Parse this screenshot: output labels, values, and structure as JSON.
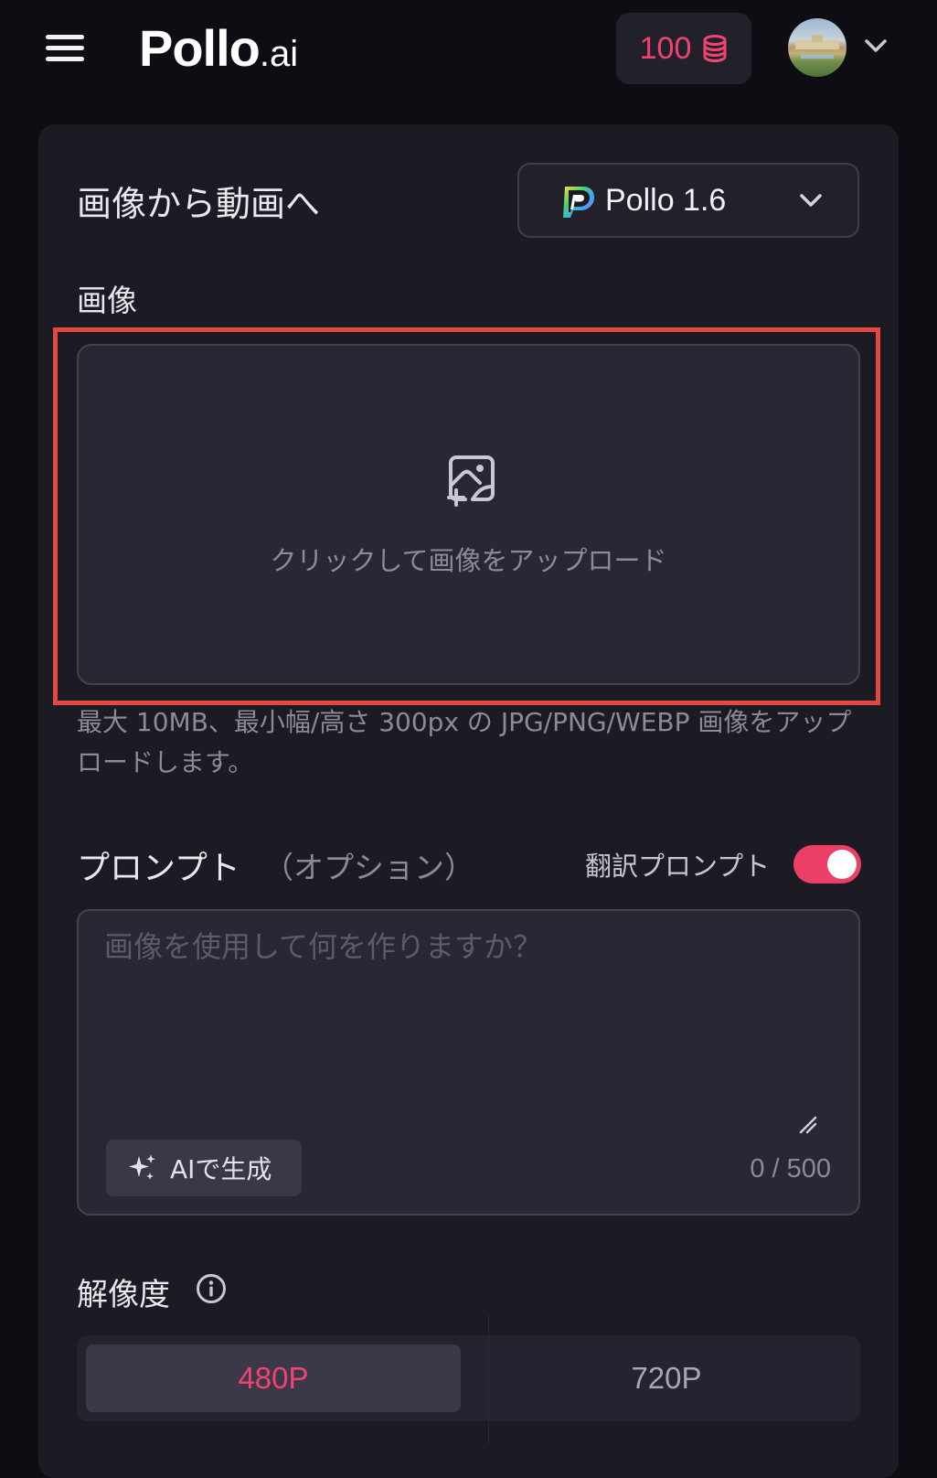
{
  "header": {
    "logo_main": "Pollo",
    "logo_suffix": ".ai",
    "credits": "100",
    "credits_icon": "coin-stack-icon",
    "avatar_icon": "user-avatar-photo"
  },
  "panel": {
    "title": "画像から動画へ",
    "model": {
      "name": "Pollo 1.6",
      "icon": "pollo-p-logo-icon"
    }
  },
  "image_section": {
    "label": "画像",
    "upload_text": "クリックして画像をアップロード",
    "upload_icon": "image-add-icon",
    "hint": "最大 10MB、最小幅/高さ 300px の JPG/PNG/WEBP 画像をアップロードします。"
  },
  "prompt_section": {
    "label": "プロンプト",
    "optional": "（オプション）",
    "translate_label": "翻訳プロンプト",
    "translate_enabled": true,
    "placeholder": "画像を使用して何を作りますか？",
    "value": "",
    "ai_button_label": "AIで生成",
    "ai_button_icon": "sparkles-icon",
    "counter": "0 / 500"
  },
  "resolution_section": {
    "label": "解像度",
    "options": [
      "480P",
      "720P"
    ],
    "selected": "480P"
  },
  "colors": {
    "accent": "#ec3f68",
    "highlight_border": "#e5483f",
    "background": "#0e0d13",
    "panel": "#1c1b24"
  }
}
